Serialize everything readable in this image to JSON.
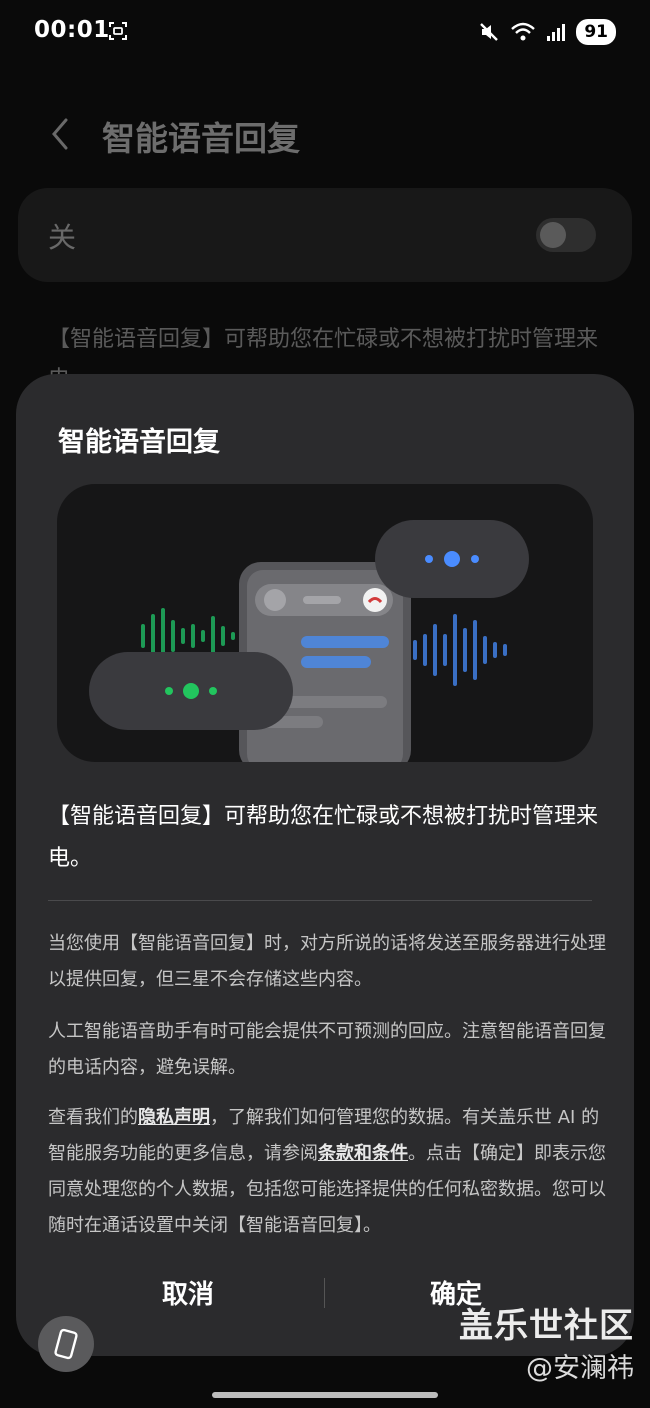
{
  "status_bar": {
    "time": "00:01",
    "battery": "91",
    "icons": [
      "screenshot-icon",
      "mute-icon",
      "wifi-icon",
      "signal-icon"
    ]
  },
  "background_page": {
    "title": "智能语音回复",
    "toggle_label": "关",
    "toggle_state": "off",
    "description": "【智能语音回复】可帮助您在忙碌或不想被打扰时管理来电。"
  },
  "dialog": {
    "title": "智能语音回复",
    "main_text": "【智能语音回复】可帮助您在忙碌或不想被打扰时管理来电。",
    "para1": "当您使用【智能语音回复】时，对方所说的话将发送至服务器进行处理以提供回复，但三星不会存储这些内容。",
    "para2": "人工智能语音助手有时可能会提供不可预测的回应。注意智能语音回复的电话内容，避免误解。",
    "para3_part1": "查看我们的",
    "para3_link1": "隐私声明",
    "para3_part2": "，了解我们如何管理您的数据。有关盖乐世 AI 的智能服务功能的更多信息，请参阅",
    "para3_link2": "条款和条件",
    "para3_part3": "。点击【确定】即表示您同意处理您的个人数据，包括您可能选择提供的任何私密数据。您可以随时在通话设置中关闭【智能语音回复】。",
    "cancel_label": "取消",
    "ok_label": "确定"
  },
  "watermark": {
    "main": "盖乐世社区",
    "sub": "@安澜祎"
  },
  "colors": {
    "accent_blue": "#4a8cff",
    "accent_green": "#22c55e",
    "dialog_bg": "#2b2b2d"
  }
}
